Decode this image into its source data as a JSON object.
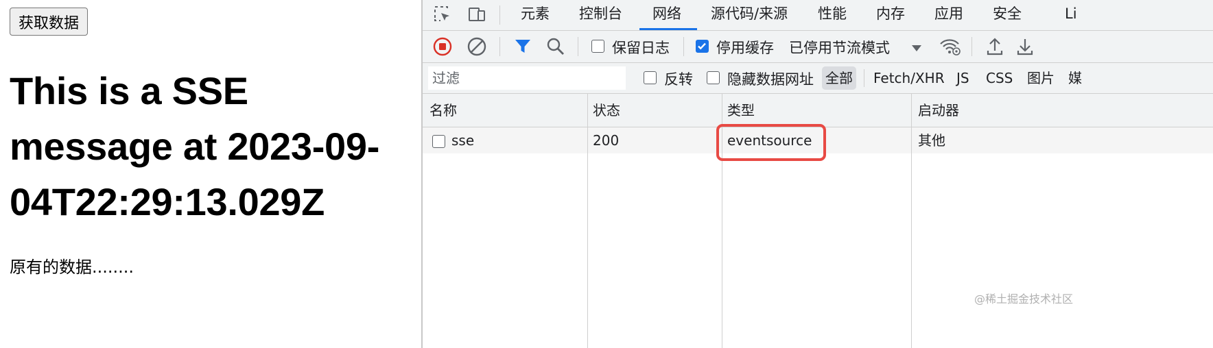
{
  "page": {
    "button_label": "获取数据",
    "sse_message": "This is a SSE message at 2023-09-04T22:29:13.029Z",
    "original_data": "原有的数据........"
  },
  "devtools": {
    "tabs": [
      "元素",
      "控制台",
      "网络",
      "源代码/来源",
      "性能",
      "内存",
      "应用",
      "安全",
      "Li"
    ],
    "active_tab": "网络",
    "toolbar": {
      "preserve_log": {
        "label": "保留日志",
        "checked": false
      },
      "disable_cache": {
        "label": "停用缓存",
        "checked": true
      },
      "throttle_label": "已停用节流模式"
    },
    "filter": {
      "placeholder": "过滤",
      "invert": {
        "label": "反转",
        "checked": false
      },
      "hide_data_urls": {
        "label": "隐藏数据网址",
        "checked": false
      },
      "types": [
        "全部",
        "Fetch/XHR",
        "JS",
        "CSS",
        "图片",
        "媒"
      ],
      "active_type": "全部"
    },
    "columns": [
      "名称",
      "状态",
      "类型",
      "启动器"
    ],
    "rows": [
      {
        "name": "sse",
        "status": "200",
        "type": "eventsource",
        "initiator": "其他"
      }
    ]
  },
  "watermark": "@稀土掘金技术社区",
  "colors": {
    "accent": "#1a73e8",
    "record_red": "#d93025",
    "highlight": "#e84a44"
  }
}
